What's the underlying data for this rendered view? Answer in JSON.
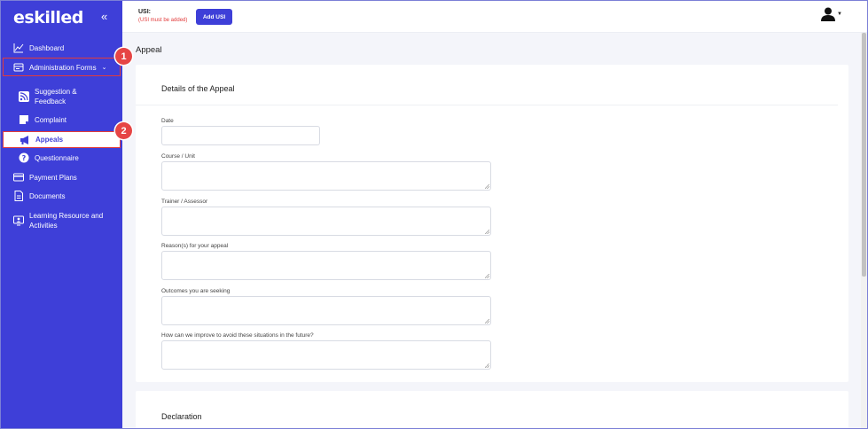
{
  "sidebar": {
    "logo": "eskilled",
    "collapse_icon": "«",
    "items": [
      {
        "label": "Dashboard",
        "icon": "chart-line-icon"
      },
      {
        "label": "Administration Forms",
        "icon": "forms-icon"
      },
      {
        "label": "Suggestion & Feedback",
        "icon": "rss-icon"
      },
      {
        "label": "Complaint",
        "icon": "note-icon"
      },
      {
        "label": "Appeals",
        "icon": "megaphone-icon"
      },
      {
        "label": "Questionnaire",
        "icon": "question-icon"
      },
      {
        "label": "Payment Plans",
        "icon": "credit-card-icon"
      },
      {
        "label": "Documents",
        "icon": "document-icon"
      },
      {
        "label": "Learning Resource and Activities",
        "icon": "monitor-user-icon"
      }
    ]
  },
  "annotations": {
    "step1": "1",
    "step2": "2"
  },
  "header": {
    "usi_label": "USI:",
    "usi_note": "(USI must be added)",
    "add_usi_button": "Add USI"
  },
  "main": {
    "page_title": "Appeal",
    "card_title": "Details of the Appeal",
    "fields": [
      {
        "label": "Date",
        "value": ""
      },
      {
        "label": "Course / Unit",
        "value": ""
      },
      {
        "label": "Trainer / Assessor",
        "value": ""
      },
      {
        "label": "Reason(s) for your appeal",
        "value": ""
      },
      {
        "label": "Outcomes you are seeking",
        "value": ""
      },
      {
        "label": "How can we improve to avoid these situations in the future?",
        "value": ""
      }
    ],
    "declaration_title": "Declaration"
  },
  "colors": {
    "sidebar": "#3e3fd8",
    "accent": "#3e3fd8",
    "highlight": "#e23b3b",
    "background": "#f4f5fa"
  }
}
